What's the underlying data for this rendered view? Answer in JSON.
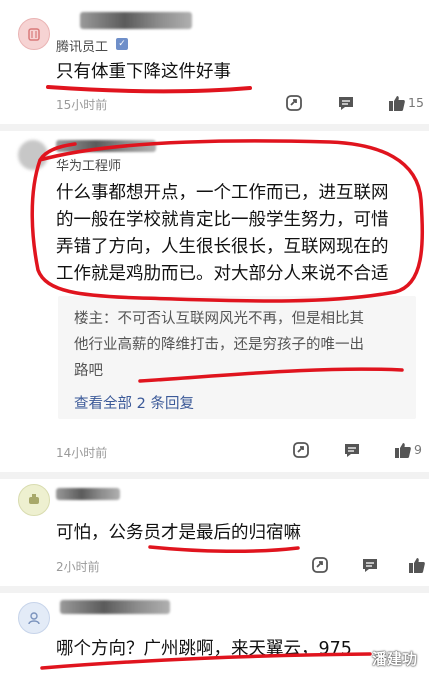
{
  "comments": [
    {
      "user_tag": "腾讯员工",
      "verified_badge": "verified-badge-icon",
      "text_lines": [
        "只有体重下降这件好事"
      ],
      "time": "15小时前",
      "likes": "15",
      "avatar_color": "#f4c8c8"
    },
    {
      "user_tag": "华为工程师",
      "text_lines": [
        "什么事都想开点，一个工作而已，进互联网",
        "的一般在学校就肯定比一般学生努力，可惜",
        "弄错了方向，人生很长很长，互联网现在的",
        "工作就是鸡肋而已。对大部分人来说不合适"
      ],
      "reply": {
        "author": "楼主",
        "text_lines": [
          "楼主：不可否认互联网风光不再，但是相比其",
          "他行业高薪的降维打击，还是穷孩子的唯一出",
          "路吧"
        ],
        "view_all": "查看全部 2 条回复"
      },
      "time": "14小时前",
      "likes": "9"
    },
    {
      "text_lines": [
        "可怕，公务员才是最后的归宿嘛"
      ],
      "time": "2小时前",
      "avatar_color": "#e9eec9"
    },
    {
      "text_lines": [
        "哪个方向？广州跳啊，来天翼云，975"
      ],
      "avatar_color": "#e3ebf7"
    }
  ],
  "watermark": "潘建功",
  "colors": {
    "annotation_red": "#e0141e",
    "link_blue": "#3b5998"
  }
}
